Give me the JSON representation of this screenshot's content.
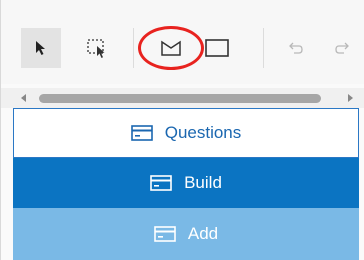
{
  "toolbar": {
    "tools": [
      {
        "name": "select-arrow",
        "icon": "cursor-arrow-icon",
        "selected": true
      },
      {
        "name": "marquee-select",
        "icon": "marquee-select-icon",
        "selected": false
      },
      {
        "name": "pentagon-shape",
        "icon": "pentagon-icon",
        "selected": false
      },
      {
        "name": "rectangle-shape",
        "icon": "rectangle-icon",
        "selected": false
      },
      {
        "name": "undo",
        "icon": "undo-icon",
        "selected": false
      },
      {
        "name": "redo",
        "icon": "redo-icon",
        "selected": false
      }
    ],
    "annotation_color": "#e8231f"
  },
  "panel": {
    "rows": [
      {
        "label": "Questions",
        "icon": "card-icon",
        "style": "outlined",
        "color": "#1b67b0"
      },
      {
        "label": "Build",
        "icon": "card-icon",
        "style": "filled",
        "color": "#0b74c2"
      },
      {
        "label": "Add",
        "icon": "card-icon",
        "style": "light",
        "color": "#7ab9e6"
      }
    ]
  }
}
